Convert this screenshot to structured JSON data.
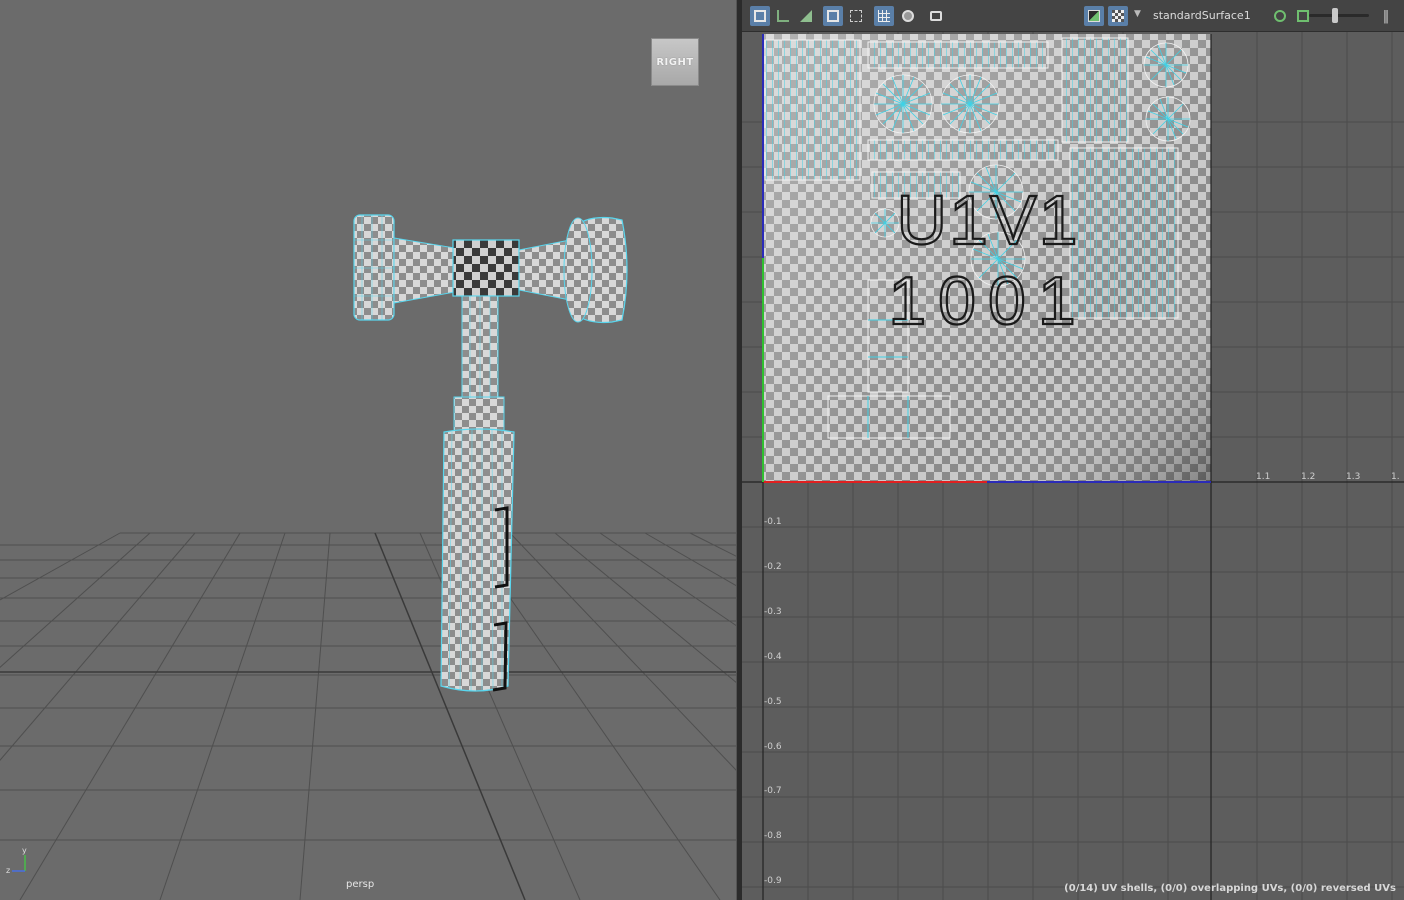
{
  "viewport": {
    "camera_label": "persp",
    "view_cube_label": "RIGHT",
    "axis_y": "y",
    "axis_z": "z"
  },
  "uv_editor": {
    "shader_name": "standardSurface1",
    "tile_label_top": "U1V1",
    "tile_label_bottom": "1001",
    "status": "(0/14) UV shells, (0/0) overlapping UVs, (0/0) reversed UVs",
    "u_ticks": [
      "1.1",
      "1.2",
      "1.3",
      "1."
    ],
    "v_ticks": [
      "-0.1",
      "-0.2",
      "-0.3",
      "-0.4",
      "-0.5",
      "-0.6",
      "-0.7",
      "-0.8",
      "-0.9"
    ],
    "toolbar_icons": [
      "uv-layout-icon",
      "uv-grid-icon",
      "uv-shell-icon",
      "frame-all-icon",
      "frame-selected-icon",
      "grid-toggle-icon",
      "sphere-icon",
      "snapshot-icon",
      "image-display-icon",
      "checker-icon",
      "shader-dropdown-icon",
      "uv-sync-icon",
      "texture-icon",
      "exposure-slider-icon",
      "toolbar-extend-icon"
    ]
  },
  "colors": {
    "viewport_bg": "#6b6b6b",
    "uv_wire": "#3fd2e6",
    "u_axis": "#e02020",
    "v_axis": "#30c030"
  }
}
